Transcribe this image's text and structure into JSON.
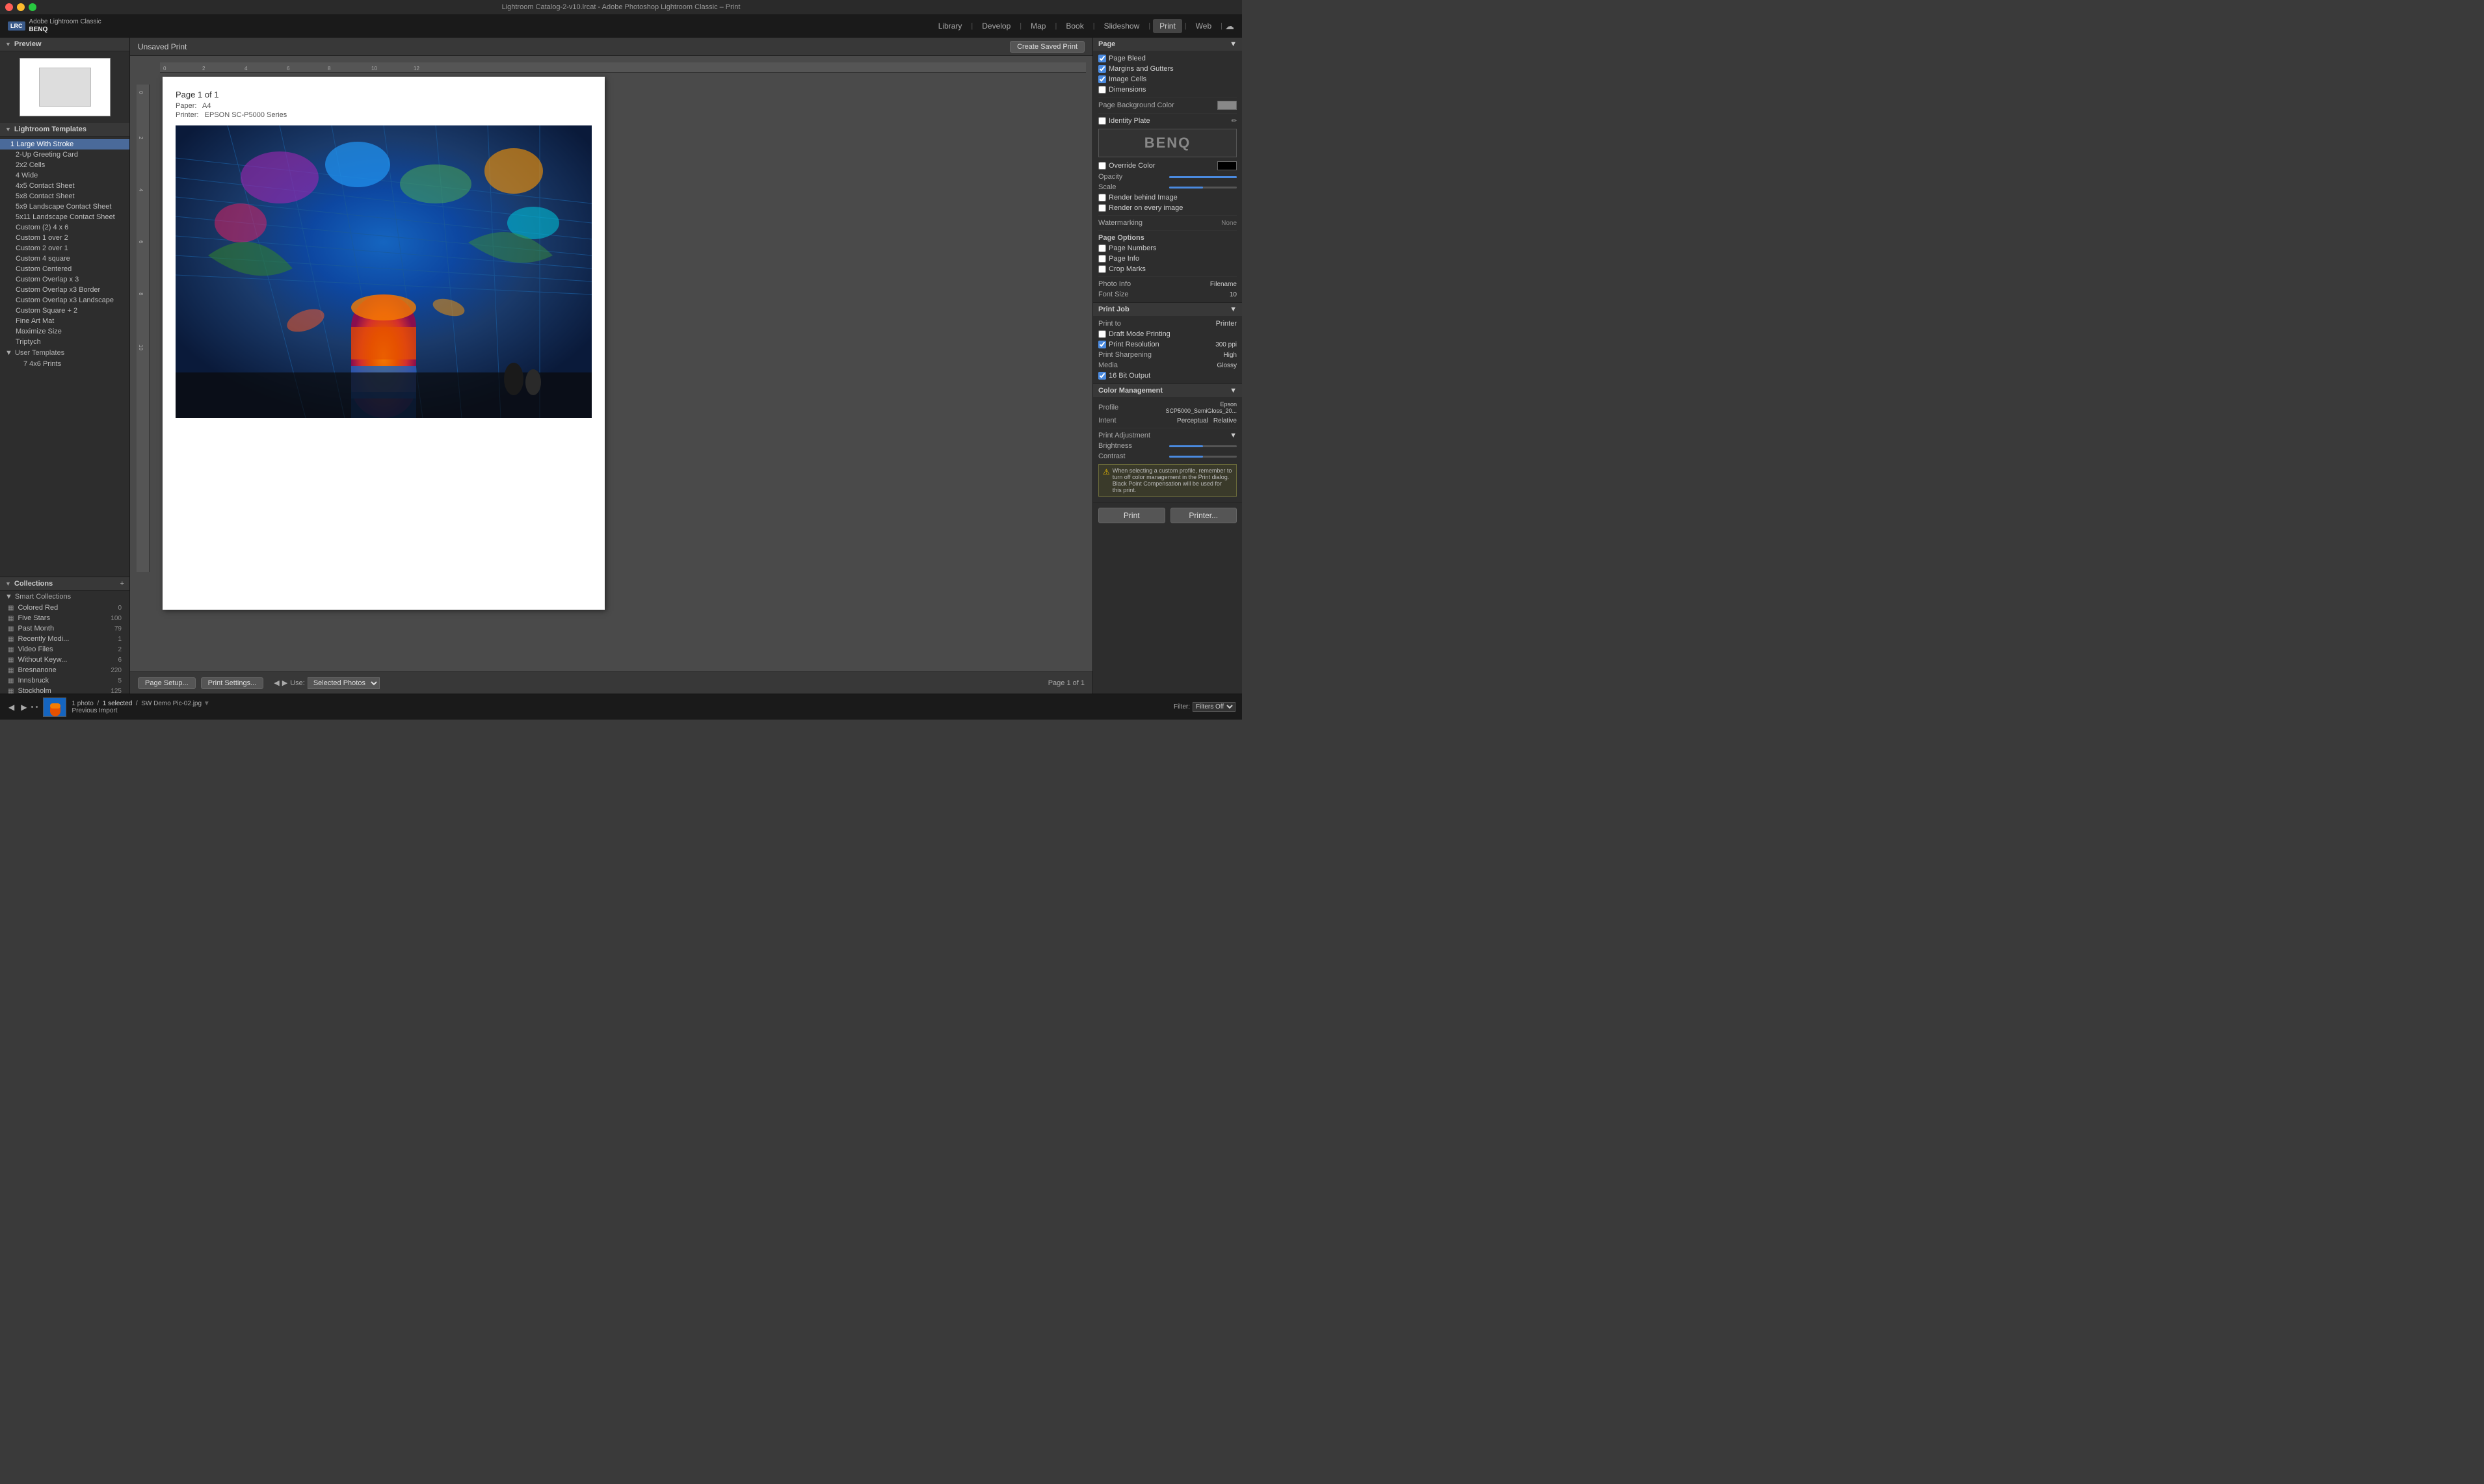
{
  "titlebar": {
    "title": "Lightroom Catalog-2-v10.lrcat - Adobe Photoshop Lightroom Classic – Print"
  },
  "topnav": {
    "logo_line1": "Adobe Lightroom Classic",
    "logo_line2": "BENQ",
    "nav_items": [
      "Library",
      "Develop",
      "Map",
      "Book",
      "Slideshow",
      "Print",
      "Web"
    ],
    "active_nav": "Print"
  },
  "left_panel": {
    "preview_label": "Preview",
    "template_section": "Lightroom Templates",
    "templates": [
      "1 Large With Stroke",
      "2-Up Greeting Card",
      "2x2 Cells",
      "4 Wide",
      "4x5 Contact Sheet",
      "5x8 Contact Sheet",
      "5x9 Landscape Contact Sheet",
      "5x11 Landscape Contact Sheet",
      "Custom (2) 4 x 6",
      "Custom 1 over 2",
      "Custom 2 over 1",
      "Custom 4 square",
      "Custom Centered",
      "Custom Overlap x 3",
      "Custom Overlap x3 Border",
      "Custom Overlap x3 Landscape",
      "Custom Square + 2",
      "Fine Art Mat",
      "Maximize Size",
      "Triptych"
    ],
    "user_templates_label": "User Templates",
    "user_templates": [
      "7 4x6 Prints"
    ],
    "collections_label": "Collections",
    "add_collection_label": "+",
    "smart_collections_label": "Smart Collections",
    "collections": [
      {
        "name": "Colored Red",
        "count": "0"
      },
      {
        "name": "Five Stars",
        "count": "100"
      },
      {
        "name": "Past Month",
        "count": "79"
      },
      {
        "name": "Recently Modi...",
        "count": "1"
      },
      {
        "name": "Video Files",
        "count": "2"
      },
      {
        "name": "Without Keyw...",
        "count": "6"
      },
      {
        "name": "Bresnanone",
        "count": "220"
      },
      {
        "name": "Innsbruck",
        "count": "5"
      },
      {
        "name": "Stockholm",
        "count": "125"
      }
    ]
  },
  "print_area": {
    "toolbar_title": "Unsaved Print",
    "create_saved_btn": "Create Saved Print",
    "page_label": "Page 1 of 1",
    "paper_label": "Paper:",
    "paper_value": "A4",
    "printer_label": "Printer:",
    "printer_value": "EPSON SC-P5000 Series",
    "bottom": {
      "setup_btn": "Page Setup...",
      "settings_btn": "Print Settings...",
      "use_label": "Use:",
      "use_value": "Selected Photos",
      "page_count": "Page 1 of 1"
    }
  },
  "right_panel": {
    "page_section": {
      "title": "Page",
      "checkboxes": [
        {
          "label": "Page Bleed",
          "checked": true
        },
        {
          "label": "Margins and Gutters",
          "checked": true
        },
        {
          "label": "Image Cells",
          "checked": true
        },
        {
          "label": "Dimensions",
          "checked": false
        }
      ],
      "bg_color_label": "Page Background Color",
      "identity_plate_label": "Identity Plate",
      "benq_text": "BENQ",
      "override_color_label": "Override Color",
      "opacity_label": "Opacity",
      "scale_label": "Scale",
      "render_behind_label": "Render behind Image",
      "render_on_every_label": "Render on every image",
      "watermarking_label": "Watermarking",
      "watermarking_value": "None",
      "page_options_label": "Page Options",
      "page_numbers_label": "Page Numbers",
      "page_info_label": "Page Info",
      "crop_marks_label": "Crop Marks",
      "photo_info_label": "Photo Info",
      "photo_info_value": "Filename",
      "font_size_label": "Font Size",
      "font_size_value": "10"
    },
    "print_job_section": {
      "title": "Print Job",
      "print_to_label": "Print to",
      "print_to_value": "Printer",
      "draft_mode_label": "Draft Mode Printing",
      "print_resolution_label": "Print Resolution",
      "print_resolution_value": "300",
      "print_resolution_unit": "ppi",
      "print_sharpening_label": "Print Sharpening",
      "print_sharpening_value": "High",
      "media_label": "Media",
      "media_value": "Glossy",
      "bit_output_label": "16 Bit Output",
      "bit_output_checked": true
    },
    "color_management_section": {
      "title": "Color Management",
      "profile_label": "Profile",
      "profile_value": "Epson SCP5000_SemiGloss_20...",
      "intent_label": "Intent",
      "intent_value": "Perceptual",
      "rendering_label": "Relative",
      "print_adjustment_label": "Print Adjustment",
      "brightness_label": "Brightness",
      "contrast_label": "Contrast",
      "warning_text": "When selecting a custom profile, remember to turn off color management in the Print dialog. Black Point Compensation will be used for this print."
    },
    "actions": {
      "print_btn": "Print",
      "printer_btn": "Printer..."
    }
  },
  "filmstrip": {
    "photo_count": "1 photo",
    "selected_label": "1 selected",
    "file_name": "SW Demo Pic-02.jpg",
    "filter_label": "Filter:",
    "filter_value": "Filters Off",
    "previous_import": "Previous Import"
  }
}
